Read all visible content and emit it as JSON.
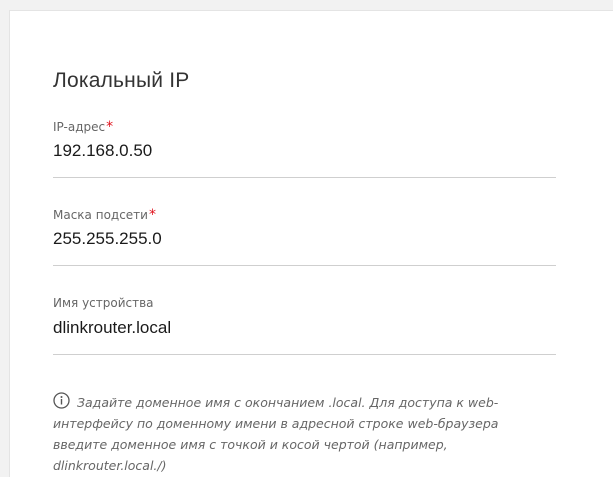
{
  "section": {
    "title": "Локальный IP"
  },
  "fields": [
    {
      "label": "IP-адрес",
      "required_mark": "*",
      "value": "192.168.0.50"
    },
    {
      "label": "Маска подсети",
      "required_mark": "*",
      "value": "255.255.255.0"
    },
    {
      "label": "Имя устройства",
      "value": "dlinkrouter.local"
    }
  ],
  "hint": {
    "icon": "info-icon",
    "text": "Задайте доменное имя с окончанием .local. Для доступа к web-интерфейсу по доменному имени в адресной строке web-браузера введите доменное имя с точкой и косой чертой (например, dlinkrouter.local./)"
  },
  "colors": {
    "required": "#e0111c",
    "label": "#666666",
    "value": "#1a1a1a",
    "divider": "#cfcfcf"
  }
}
